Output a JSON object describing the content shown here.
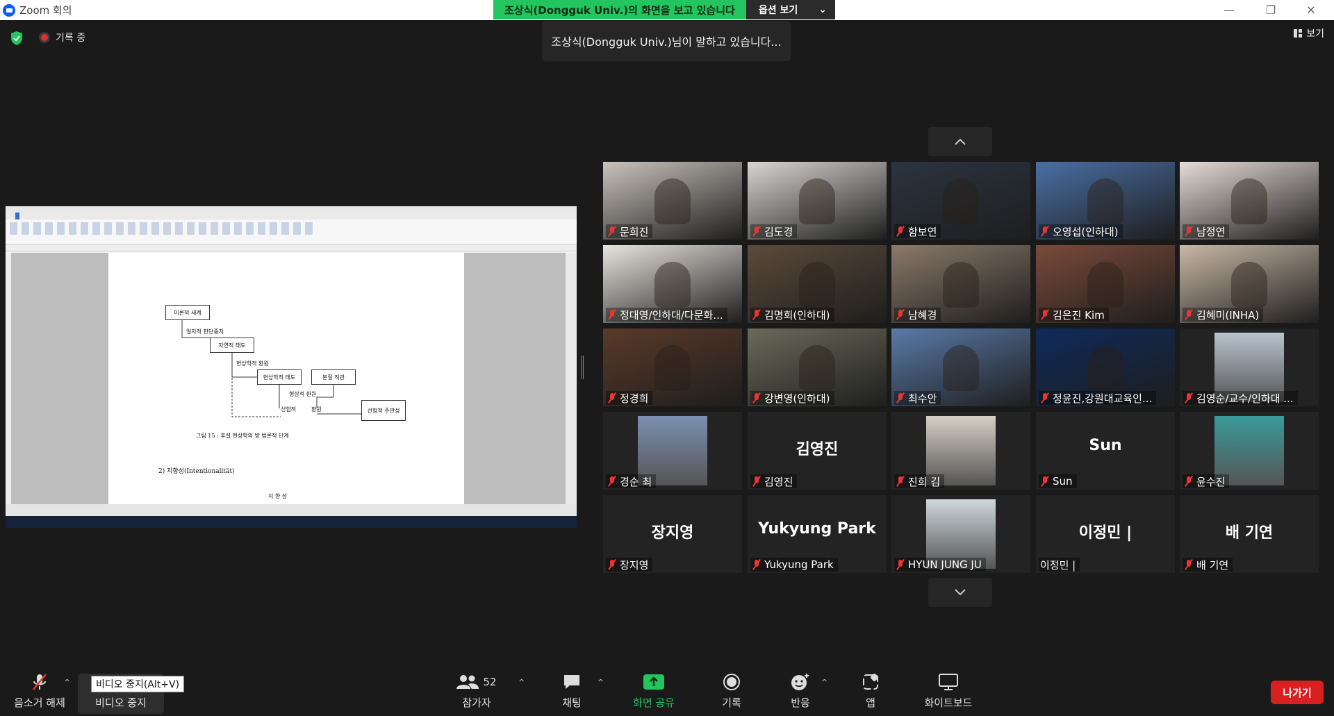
{
  "window": {
    "title": "Zoom 회의"
  },
  "share_banner": {
    "text": "조상식(Dongguk  Univ.)의 화면을 보고 있습니다",
    "options_label": "옵션 보기"
  },
  "status": {
    "recording_label": "기록 중",
    "speaking_text": "조상식(Dongguk  Univ.)님이 말하고 있습니다...",
    "view_label": "보기"
  },
  "shared_doc": {
    "boxes": [
      "이론적 세계",
      "자연적 태도",
      "현상학적 태도",
      "본질 직관",
      "형상적 환원",
      "선험적 주관성"
    ],
    "labels": [
      "일차적 판단중지",
      "현상학적 환원",
      "선험적",
      "환원"
    ],
    "caption": "그림 15 : 후설 현상학의 방 법론적 단계",
    "heading": "2) 지향성(Intentionalität)",
    "arc_text": "지 향 성"
  },
  "participants": [
    {
      "name": "문희진",
      "muted": true,
      "bg": "#c9c3bd"
    },
    {
      "name": "김도경",
      "muted": true,
      "bg": "#d8d6d2"
    },
    {
      "name": "함보연",
      "muted": true,
      "bg": "#2c3440"
    },
    {
      "name": "오영섭(인하대)",
      "muted": true,
      "bg": "#4a6fa5"
    },
    {
      "name": "남정연",
      "muted": true,
      "bg": "#e6dcd8"
    },
    {
      "name": "정대영/인하대/다문화...",
      "muted": true,
      "bg": "#e8e4de"
    },
    {
      "name": "김명희(인하대)",
      "muted": true,
      "bg": "#5b4a3a"
    },
    {
      "name": "남혜경",
      "muted": true,
      "bg": "#8a7a6a"
    },
    {
      "name": "김은진 Kim",
      "muted": true,
      "bg": "#7a4a3a"
    },
    {
      "name": "김혜미(INHA)",
      "muted": true,
      "bg": "#c8b8a6"
    },
    {
      "name": "정경희",
      "muted": true,
      "bg": "#5a3a2a"
    },
    {
      "name": "강변영(인하대)",
      "muted": true,
      "bg": "#6a6a5a"
    },
    {
      "name": "최수안",
      "muted": true,
      "bg": "#5a7aa8"
    },
    {
      "name": "정윤진,강원대교육인...",
      "muted": true,
      "bg": "#0f2a5a"
    },
    {
      "name": "김영순/교수/인하대 ...",
      "muted": true,
      "bg": "#232323",
      "photo": "#b8c4d0"
    },
    {
      "name": "경순 최",
      "muted": true,
      "bg": "#232323",
      "photo": "#7a8fb0"
    },
    {
      "name": "김영진",
      "muted": true,
      "bg": "#232323",
      "big": "김영진"
    },
    {
      "name": "진희 김",
      "muted": true,
      "bg": "#232323",
      "photo": "#d6cfc4"
    },
    {
      "name": "Sun",
      "muted": true,
      "bg": "#232323",
      "big": "Sun"
    },
    {
      "name": "윤수진",
      "muted": true,
      "bg": "#232323",
      "photo": "#3a9a9a"
    },
    {
      "name": "장지영",
      "muted": true,
      "bg": "#232323",
      "big": "장지영"
    },
    {
      "name": "Yukyung Park",
      "muted": true,
      "bg": "#232323",
      "big": "Yukyung Park"
    },
    {
      "name": "HYUN JUNG JU",
      "muted": true,
      "bg": "#232323",
      "photo": "#cfd8dc"
    },
    {
      "name": "이정민 |",
      "muted": false,
      "bg": "#232323",
      "big": "이정민 |"
    },
    {
      "name": "배 기연",
      "muted": true,
      "bg": "#232323",
      "big": "배 기연"
    }
  ],
  "toolbar": {
    "unmute": "음소거 해제",
    "stop_video": "비디오 중지",
    "stop_video_tooltip": "비디오 중지(Alt+V)",
    "participants": "참가자",
    "participants_count": "52",
    "chat": "채팅",
    "share": "화면 공유",
    "record": "기록",
    "reactions": "반응",
    "apps": "앱",
    "whiteboard": "화이트보드",
    "leave": "나가기"
  },
  "colors": {
    "share_green": "#22c55e",
    "leave_red": "#d92020",
    "mute_red": "#e33333"
  }
}
